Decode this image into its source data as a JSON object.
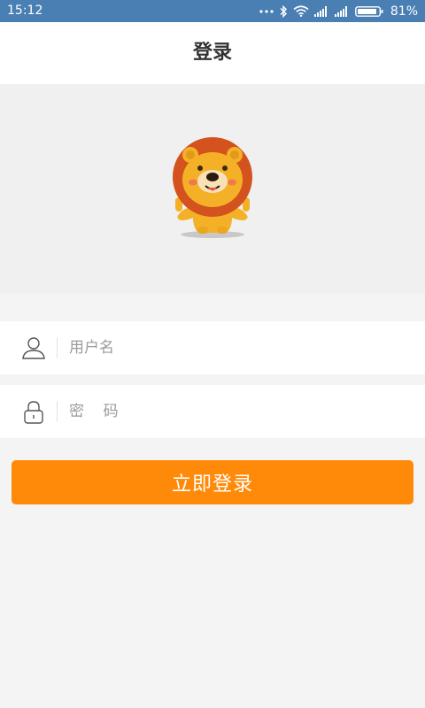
{
  "status_bar": {
    "time": "15:12",
    "battery": "81%",
    "icons": [
      "more-dots-icon",
      "bluetooth-icon",
      "wifi-icon",
      "signal-icon",
      "signal-icon",
      "battery-icon"
    ]
  },
  "header": {
    "title": "登录"
  },
  "hero": {
    "image": "lion-mascot"
  },
  "form": {
    "username": {
      "placeholder": "用户名",
      "value": "",
      "icon": "user-icon"
    },
    "password": {
      "placeholder": "密    码",
      "value": "",
      "icon": "lock-icon"
    },
    "submit_label": "立即登录"
  },
  "colors": {
    "status_bar": "#4a7fb3",
    "accent": "#ff8a09",
    "mascot_mane": "#d3521e",
    "mascot_face": "#f4b128"
  }
}
